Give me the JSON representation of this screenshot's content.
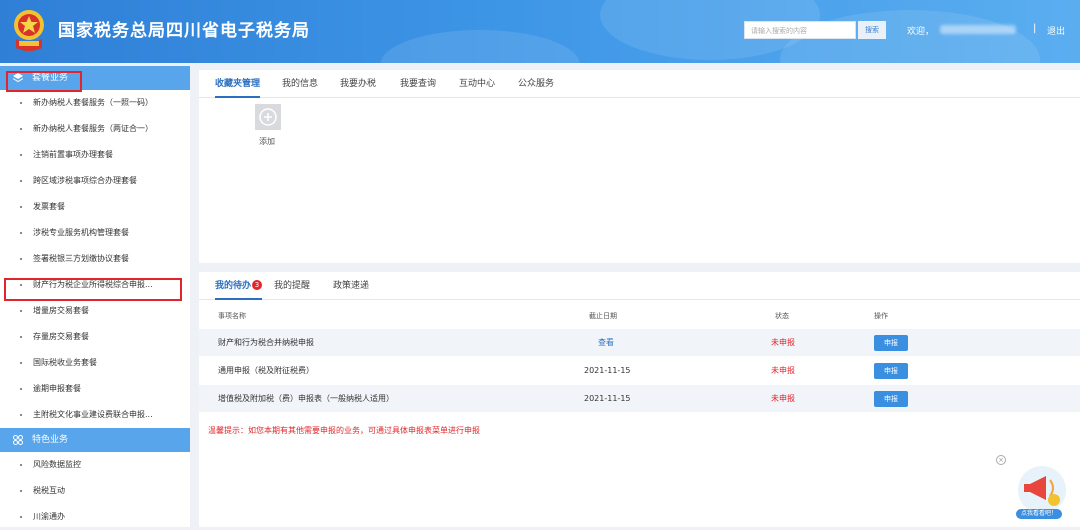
{
  "header": {
    "title": "国家税务总局四川省电子税务局",
    "search_placeholder": "请输入搜索的内容",
    "search_button": "搜索",
    "welcome": "欢迎，",
    "separator": "|",
    "logout": "退出"
  },
  "sidebar": {
    "section1": {
      "title": "套餐业务",
      "items": [
        "新办纳税人套餐服务（一照一码）",
        "新办纳税人套餐服务（两证合一）",
        "注销前置事项办理套餐",
        "跨区域涉税事项综合办理套餐",
        "发票套餐",
        "涉税专业服务机构管理套餐",
        "签署税银三方划缴协议套餐",
        "财产行为税企业所得税综合申报...",
        "增量房交易套餐",
        "存量房交易套餐",
        "国际税收业务套餐",
        "逾期申报套餐",
        "主附税文化事业建设费联合申报..."
      ]
    },
    "section2": {
      "title": "特色业务",
      "items": [
        "风险数据监控",
        "税税互动",
        "川渝通办"
      ]
    }
  },
  "top_panel": {
    "tabs": [
      "收藏夹管理",
      "我的信息",
      "我要办税",
      "我要查询",
      "互动中心",
      "公众服务"
    ],
    "add_label": "添加"
  },
  "bottom_panel": {
    "tabs": [
      "我的待办",
      "我的提醒",
      "政策速递"
    ],
    "todo_count": "3",
    "columns": [
      "事项名称",
      "截止日期",
      "状态",
      "操作"
    ],
    "rows": [
      {
        "name": "财产和行为税合并纳税申报",
        "date": "查看",
        "status": "未申报",
        "action": "申报"
      },
      {
        "name": "通用申报（税及附征税费）",
        "date": "2021-11-15",
        "status": "未申报",
        "action": "申报"
      },
      {
        "name": "增值税及附加税（费）申报表（一般纳税人适用）",
        "date": "2021-11-15",
        "status": "未申报",
        "action": "申报"
      }
    ],
    "tip": "温馨提示：如您本期有其他需要申报的业务，可通过具体申报表菜单进行申报"
  },
  "float_widget": {
    "label": "点我看看吧！",
    "close": "×"
  },
  "colors": {
    "header_blue": "#2f7fd6",
    "sidebar_section": "#58a5ec",
    "highlight_red": "#e0262c",
    "link_blue": "#2c6fc0",
    "button_blue": "#3b8fe0"
  }
}
